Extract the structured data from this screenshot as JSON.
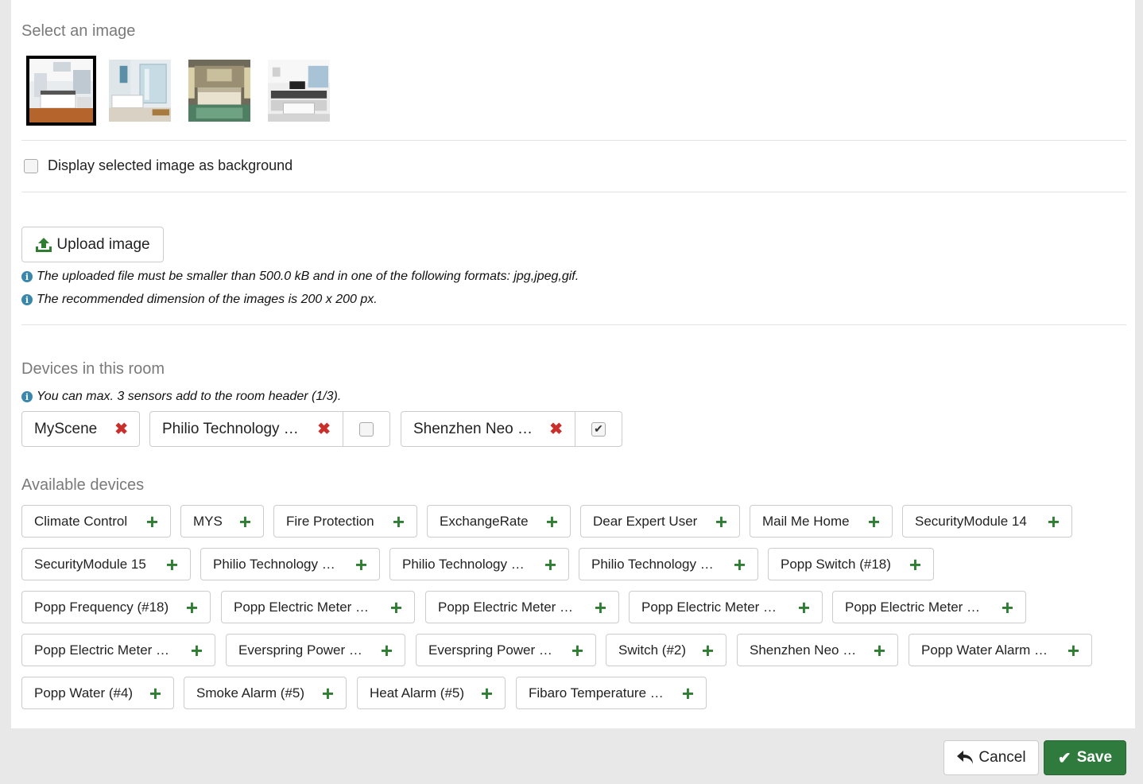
{
  "select_image": {
    "title": "Select an image",
    "thumbnails": [
      "kitchen",
      "bathroom",
      "bedroom",
      "living-room"
    ],
    "selected_index": 0
  },
  "background_option": {
    "label": "Display selected image as background",
    "checked": false
  },
  "upload": {
    "button_label": "Upload image",
    "info_size": "The uploaded file must be smaller than 500.0 kB and in one of the following formats: jpg,jpeg,gif.",
    "info_dimension": "The recommended dimension of the images is 200 x 200 px."
  },
  "devices_in_room": {
    "title": "Devices in this room",
    "info": "You can max. 3 sensors add to the room header (1/3).",
    "items": [
      {
        "label": "MyScene",
        "has_header_checkbox": false,
        "header_checked": false
      },
      {
        "label": "Philio Technology …",
        "has_header_checkbox": true,
        "header_checked": false
      },
      {
        "label": "Shenzhen Neo …",
        "has_header_checkbox": true,
        "header_checked": true
      }
    ]
  },
  "available_devices": {
    "title": "Available devices",
    "rows": [
      [
        "Climate Control",
        "MYS",
        "Fire Protection",
        "ExchangeRate",
        "Dear Expert User",
        "Mail Me Home",
        "SecurityModule 14"
      ],
      [
        "SecurityModule 15",
        "Philio Technology …",
        "Philio Technology …",
        "Philio Technology …",
        "Popp Switch (#18)"
      ],
      [
        "Popp Frequency (#18)",
        "Popp Electric Meter …",
        "Popp Electric Meter …",
        "Popp Electric Meter …",
        "Popp Electric Meter …"
      ],
      [
        "Popp Electric Meter …",
        "Everspring Power …",
        "Everspring Power …",
        "Switch (#2)",
        "Shenzhen Neo …",
        "Popp Water Alarm …"
      ],
      [
        "Popp Water (#4)",
        "Smoke Alarm (#5)",
        "Heat Alarm (#5)",
        "Fibaro Temperature …"
      ]
    ]
  },
  "footer": {
    "cancel_label": "Cancel",
    "save_label": "Save"
  },
  "colors": {
    "accent_green": "#2f7a3d",
    "remove_red": "#c9302c",
    "info_blue": "#3a87ad"
  }
}
